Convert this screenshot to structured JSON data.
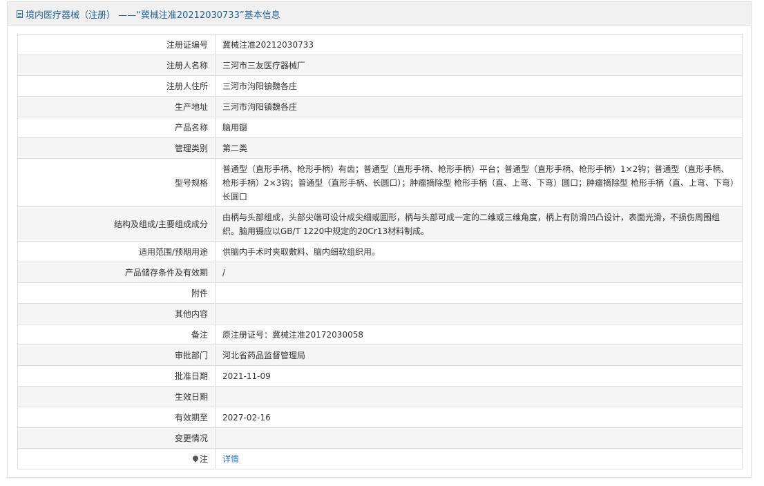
{
  "header": {
    "title": "境内医疗器械（注册） ——“冀械注准20212030733”基本信息"
  },
  "rows": [
    {
      "label": "注册证编号",
      "value": "冀械注准20212030733"
    },
    {
      "label": "注册人名称",
      "value": "三河市三友医疗器械厂"
    },
    {
      "label": "注册人住所",
      "value": "三河市泃阳镇魏各庄"
    },
    {
      "label": "生产地址",
      "value": "三河市泃阳镇魏各庄"
    },
    {
      "label": "产品名称",
      "value": "脑用镊"
    },
    {
      "label": "管理类别",
      "value": "第二类"
    },
    {
      "label": "型号规格",
      "value": "普通型（直形手柄、枪形手柄）有齿；普通型（直形手柄、枪形手柄）平台；普通型（直形手柄、枪形手柄）1×2钩；普通型（直形手柄、枪形手柄）2×3钩；普通型（直形手柄、长圆口）；肿瘤摘除型 枪形手柄（直、上弯、下弯）圆口；肿瘤摘除型 枪形手柄（直、上弯、下弯）长圆口"
    },
    {
      "label": "结构及组成/主要组成成分",
      "value": "由柄与头部组成，头部尖端可设计成尖细或圆形，柄与头部可成一定的二维或三维角度，柄上有防滑凹凸设计，表面光滑，不损伤周围组织。脑用镊应以GB/T 1220中规定的20Cr13材料制成。"
    },
    {
      "label": "适用范围/预期用途",
      "value": "供脑内手术时夹取敷料、脑内细软组织用。"
    },
    {
      "label": "产品储存条件及有效期",
      "value": "/"
    },
    {
      "label": "附件",
      "value": ""
    },
    {
      "label": "其他内容",
      "value": ""
    },
    {
      "label": "备注",
      "value": "原注册证号：冀械注准20172030058"
    },
    {
      "label": "审批部门",
      "value": "河北省药品监督管理局"
    },
    {
      "label": "批准日期",
      "value": "2021-11-09"
    },
    {
      "label": "生效日期",
      "value": ""
    },
    {
      "label": "有效期至",
      "value": "2027-02-16"
    },
    {
      "label": "变更情况",
      "value": ""
    }
  ],
  "note": {
    "label": "注",
    "icon": "note-icon",
    "link_text": "详情"
  },
  "colors": {
    "title": "#1f5f93",
    "link": "#2a7ac7",
    "header_bg": "#f0f0f0",
    "row_alt_bg": "#f5f5f5",
    "border": "#dddddd"
  }
}
